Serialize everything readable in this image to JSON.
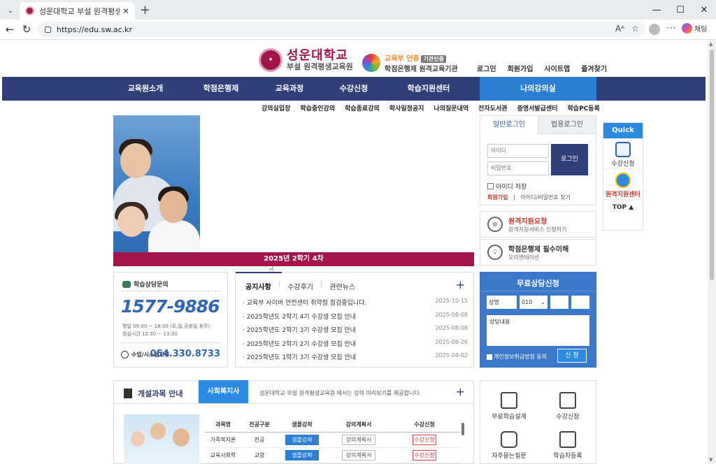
{
  "browser": {
    "tab_title": "성운대학교 부설 원격평생교육원",
    "url": "https://edu.sw.ac.kr",
    "copilot_label": "채팅"
  },
  "header": {
    "logo_main": "성운대학교",
    "logo_sub": "부설 원격평생교육원",
    "cert_line1": "교육부 인증",
    "cert_badge": "기관인증",
    "cert_line2": "학점은행제 원격교육기관",
    "util_links": [
      "로그인",
      "회원가입",
      "사이트맵",
      "즐겨찾기"
    ]
  },
  "gnb": {
    "items": [
      "교육원소개",
      "학점은행제",
      "교육과정",
      "수강신청",
      "학습지원센터",
      "나의강의실"
    ],
    "sub_items": [
      "강의실입장",
      "학습중인강의",
      "학습종료강의",
      "학사일정공지",
      "나의질문내역",
      "전자도서관",
      "증명서발급센터",
      "학습PC등록"
    ]
  },
  "hero": {
    "caption": "2025년 2학기 4차"
  },
  "login": {
    "tab_general": "일반로그인",
    "tab_corp": "법용로그인",
    "id_placeholder": "아이디",
    "pw_placeholder": "비밀번호",
    "button": "로그인",
    "save_id": "아이디 저장",
    "join": "회원가입",
    "sep": "|",
    "find": "아이디/비밀번호 찾기"
  },
  "remote_boxes": [
    {
      "title": "원격지원요청",
      "sub": "원격지원서비스 신청하기",
      "icon": "globe-icon"
    },
    {
      "title": "학점은행제 필수이해",
      "sub": "오리엔테이션",
      "icon": "bulb-icon"
    }
  ],
  "quick": {
    "title": "Quick",
    "items": [
      "수강신청",
      "원격지원센터"
    ],
    "top": "TOP ▲"
  },
  "counsel": {
    "title": "학습상담문의",
    "phone": "1577-9886",
    "hours_line1": "평일   09:00 ~ 18:00 (토,일,공휴일 휴무)",
    "hours_line2": "점심시간  12:30 ~ 13:30",
    "sys_label": "수업/시스템오류",
    "sys_phone": "054.330.8733"
  },
  "notice": {
    "tabs": [
      "공지사항",
      "수강후기",
      "관련뉴스"
    ],
    "items": [
      {
        "title": "· 교육부 사이버 안전센터 취약점 점검중입니다.",
        "date": "2025-10-15"
      },
      {
        "title": "· 2025학년도 2학기 4기 수강생 모집 안내",
        "date": "2025-08-08"
      },
      {
        "title": "· 2025학년도 2학기 3기 수강생 모집 안내",
        "date": "2025-08-08"
      },
      {
        "title": "· 2025학년도 2학기 2기 수강생 모집 안내",
        "date": "2025-06-26"
      },
      {
        "title": "· 2025학년도 1학기 3기 수강생 모집 안내",
        "date": "2025-04-02"
      }
    ]
  },
  "request": {
    "title": "무료상담신청",
    "name_placeholder": "성명",
    "phone_prefix": "010",
    "content_placeholder": "상담내용",
    "agree": "개인정보취급방침 동의",
    "submit": "신 청"
  },
  "courses": {
    "title": "개설과목 안내",
    "active_tab": "사회복지사",
    "desc": "성운대학교 부설 원격평생교육원 에서는 강의 미리보기를 제공합니다.",
    "headers": [
      "과목명",
      "전공구분",
      "샘플강좌",
      "강의계획서",
      "수강신청"
    ],
    "rows": [
      {
        "name": "가족복지론",
        "type": "전공",
        "sample": "샘플강좌",
        "plan": "강의계획서",
        "enroll": "수강신청"
      },
      {
        "name": "교육사회학",
        "type": "교양",
        "sample": "샘플강좌",
        "plan": "강의계획서",
        "enroll": "수강신청"
      }
    ]
  },
  "quick_icons": [
    "무료학습설계",
    "수강신청",
    "자주묻는질문",
    "학습자등록"
  ],
  "colors": {
    "brand": "#a3154a",
    "nav": "#2e4077",
    "accent": "#2b8be0"
  }
}
